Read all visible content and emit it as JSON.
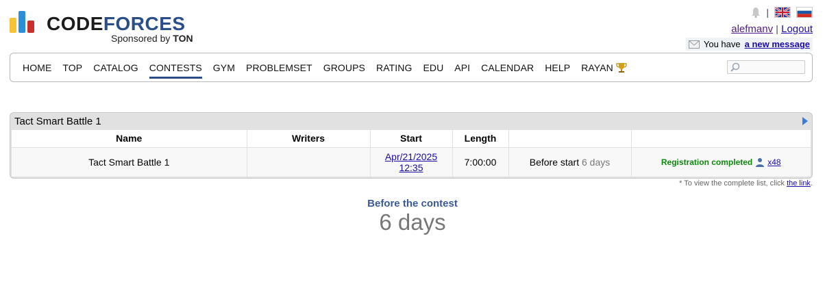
{
  "logo": {
    "text_part1": "CODE",
    "text_part2": "FORCES",
    "sponsor_prefix": "Sponsored by",
    "sponsor_name": "TON"
  },
  "top_right": {
    "separator": "|",
    "username": "alefmanv",
    "logout": "Logout",
    "message_prefix": "You have",
    "message_link": "a new message",
    "icons": [
      "bell-icon",
      "uk-flag-icon",
      "russia-flag-icon",
      "envelope-icon"
    ]
  },
  "menu": {
    "items": [
      {
        "label": "HOME"
      },
      {
        "label": "TOP"
      },
      {
        "label": "CATALOG"
      },
      {
        "label": "CONTESTS",
        "active": true
      },
      {
        "label": "GYM"
      },
      {
        "label": "PROBLEMSET"
      },
      {
        "label": "GROUPS"
      },
      {
        "label": "RATING"
      },
      {
        "label": "EDU"
      },
      {
        "label": "API"
      },
      {
        "label": "CALENDAR"
      },
      {
        "label": "HELP"
      },
      {
        "label": "RAYAN"
      }
    ],
    "search_value": ""
  },
  "contest_box": {
    "title": "Tact Smart Battle 1",
    "columns": [
      "Name",
      "Writers",
      "Start",
      "Length",
      "",
      ""
    ],
    "row": {
      "name": "Tact Smart Battle 1",
      "writers": "",
      "start_date": "Apr/21/2025",
      "start_time": "12:35",
      "length": "7:00:00",
      "before_start_label": "Before start",
      "before_start_value": "6 days",
      "registration": "Registration completed",
      "participants": "x48"
    }
  },
  "footnote": {
    "text": "* To view the complete list, click",
    "link": "the link",
    "suffix": "."
  },
  "countdown": {
    "title": "Before the contest",
    "value": "6 days"
  },
  "colors": {
    "brand_dark": "#1c1c1c",
    "brand_blue": "#2b4d8a",
    "registration_green": "#0a8a0a",
    "countdown_title": "#3b5998"
  }
}
